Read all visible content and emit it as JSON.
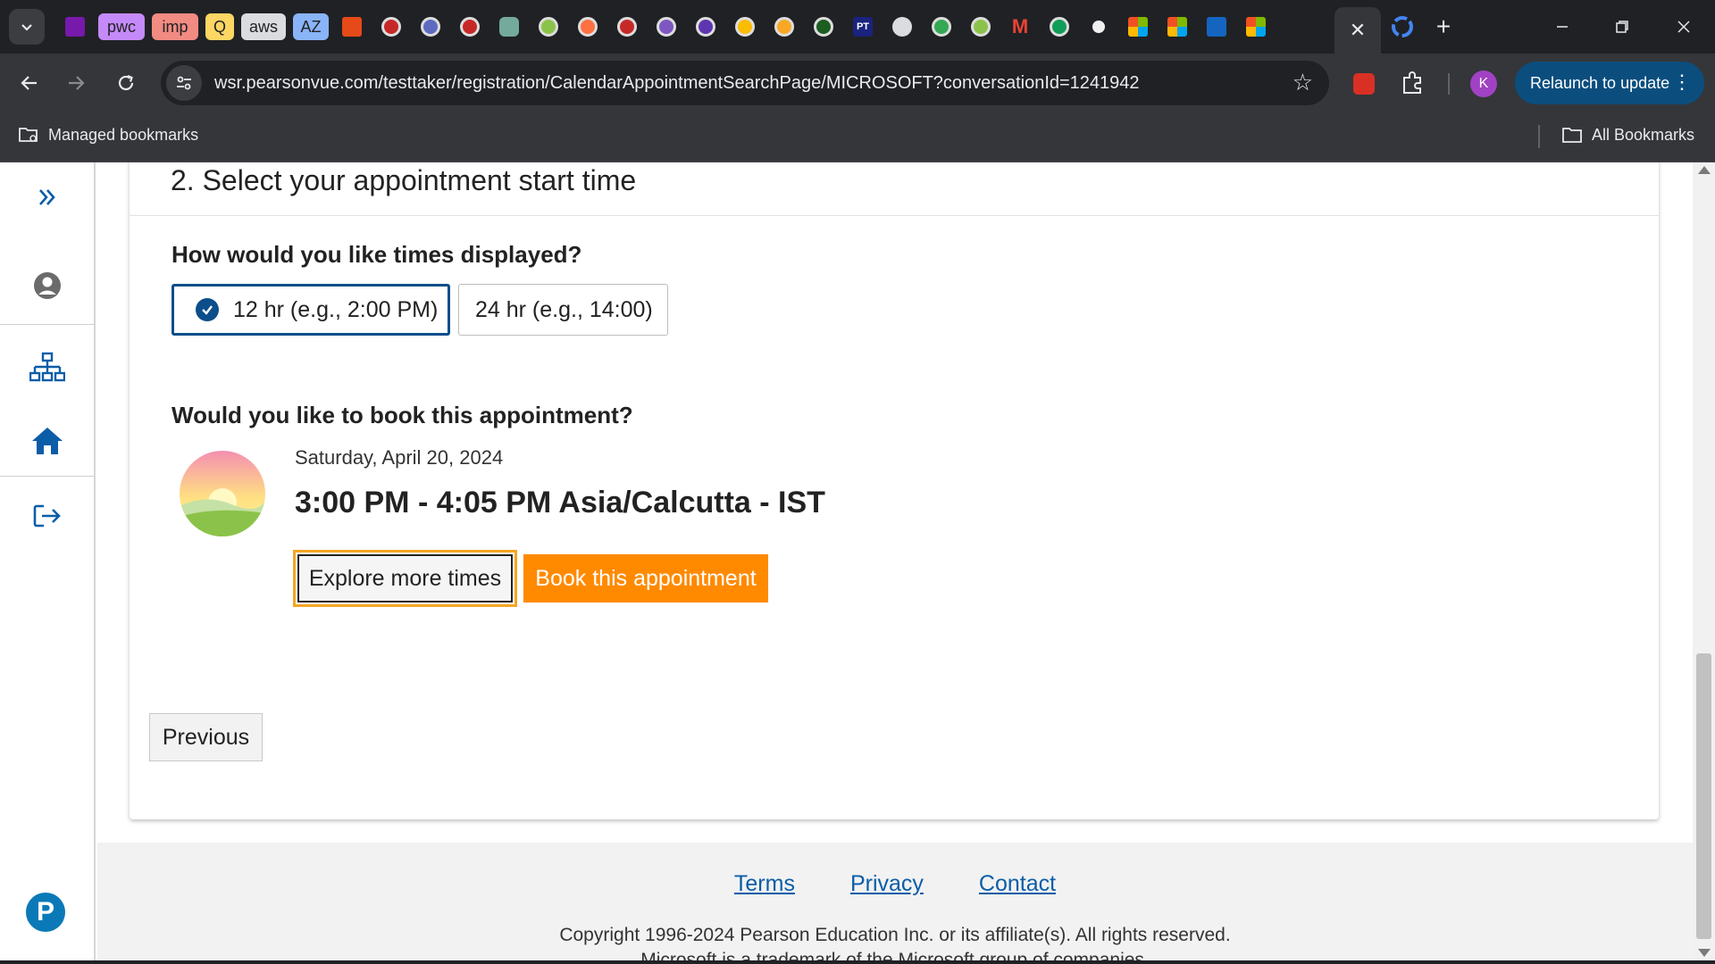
{
  "browser": {
    "tabs_pills": [
      {
        "label": "pwc",
        "color": "#c58af9"
      },
      {
        "label": "imp",
        "color": "#f28b82"
      },
      {
        "label": "Q",
        "color": "#fdd663"
      },
      {
        "label": "aws",
        "color": "#dadce0"
      },
      {
        "label": "AZ",
        "color": "#8ab4f8"
      }
    ],
    "active_tab_close": "✕",
    "new_tab": "+",
    "url": "wsr.pearsonvue.com/testtaker/registration/CalendarAppointmentSearchPage/MICROSOFT?conversationId=1241942",
    "profile_initial": "K",
    "relaunch_label": "Relaunch to update",
    "bookmarks": {
      "managed": "Managed bookmarks",
      "all": "All Bookmarks"
    }
  },
  "page": {
    "section_title": "2. Select your appointment start time",
    "time_format_question": "How would you like times displayed?",
    "format_options": [
      "12 hr (e.g., 2:00 PM)",
      "24 hr (e.g., 14:00)"
    ],
    "selected_format": "12 hr (e.g., 2:00 PM)",
    "book_question": "Would you like to book this appointment?",
    "appointment": {
      "date": "Saturday, April 20, 2024",
      "time": "3:00 PM - 4:05 PM Asia/Calcutta - IST"
    },
    "explore_label": "Explore more times",
    "book_label": "Book this appointment",
    "previous_label": "Previous"
  },
  "footer": {
    "links": [
      "Terms",
      "Privacy",
      "Contact"
    ],
    "copyright": "Copyright 1996-2024 Pearson Education Inc. or its affiliate(s). All rights reserved.",
    "trademark": "Microsoft is a trademark of the Microsoft group of companies."
  },
  "sidebar": {
    "icons": [
      "expand-icon",
      "profile-icon",
      "sitemap-icon",
      "home-icon",
      "sign-out-icon"
    ]
  },
  "colors": {
    "accent_blue": "#0b4e8a",
    "link_blue": "#0b5da8",
    "book_orange": "#ff8a00",
    "focus_yellow": "#f5a623"
  }
}
